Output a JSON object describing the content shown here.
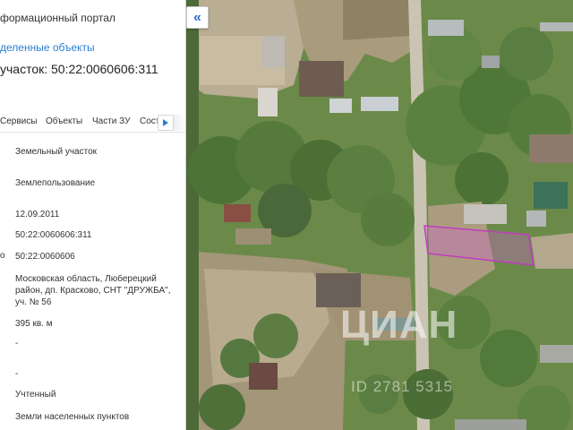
{
  "panel": {
    "portal_title": "формационный портал",
    "selected_objects_link": "деленные объекты",
    "parcel_heading": "участок: 50:22:0060606:311",
    "tabs": [
      {
        "label": "Сервисы"
      },
      {
        "label": "Объекты"
      },
      {
        "label": "Части ЗУ"
      },
      {
        "label": "Соста"
      }
    ],
    "rows": [
      {
        "marker": "",
        "value": "Земельный участок"
      },
      {
        "marker": "",
        "value": "Землепользование"
      },
      {
        "marker": "",
        "value": "12.09.2011"
      },
      {
        "marker": "",
        "value": "50:22:0060606:311"
      },
      {
        "marker": "о",
        "value": "50:22:0060606"
      },
      {
        "marker": "",
        "value": "Московская область, Люберецкий район, дп. Красково, СНТ \"ДРУЖБА\", уч. № 56"
      },
      {
        "marker": "",
        "value": "395 кв. м"
      },
      {
        "marker": "",
        "value": "-"
      },
      {
        "marker": "",
        "value": "-"
      },
      {
        "marker": "",
        "value": "Учтенный"
      },
      {
        "marker": "",
        "value": "Земли населенных пунктов"
      }
    ]
  },
  "map": {
    "collapse_label": "«",
    "watermark_logo": "ЦИАН",
    "watermark_id": "ID 2781 5315",
    "parcel_outline_color": "#c03cc0"
  }
}
